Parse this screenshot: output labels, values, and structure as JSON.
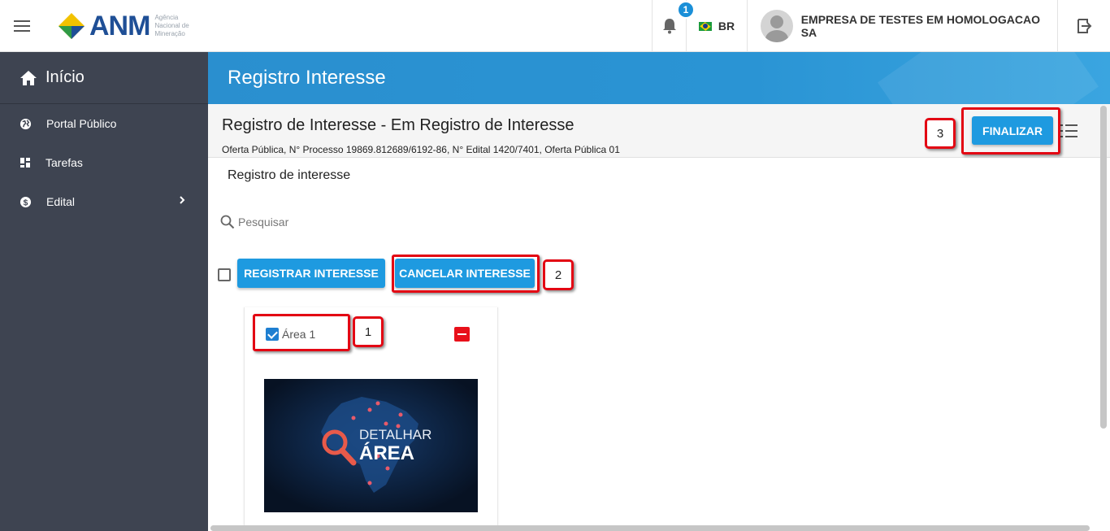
{
  "header": {
    "logo_text": "ANM",
    "logo_subtitle": "Agência Nacional de Mineração",
    "notification_count": "1",
    "language": "BR",
    "user_name": "EMPRESA DE TESTES EM HOMOLOGACAO SA"
  },
  "sidebar": {
    "home_label": "Início",
    "items": [
      {
        "label": "Portal Público",
        "icon": "globe-icon"
      },
      {
        "label": "Tarefas",
        "icon": "grid-icon"
      },
      {
        "label": "Edital",
        "icon": "dollar-icon"
      }
    ]
  },
  "page": {
    "banner_title": "Registro Interesse",
    "title": "Registro de Interesse - Em Registro de Interesse",
    "subtitle": "Oferta Pública, N° Processo 19869.812689/6192-86, N° Edital 1420/7401, Oferta Pública 01",
    "finalize_label": "FINALIZAR",
    "section_label": "Registro de interesse",
    "search_placeholder": "Pesquisar",
    "register_label": "REGISTRAR INTERESSE",
    "cancel_label": "CANCELAR INTERESSE"
  },
  "card": {
    "area_label": "Área 1",
    "checked": true,
    "image_line1": "DETALHAR",
    "image_line2": "ÁREA"
  },
  "annotations": [
    "1",
    "2",
    "3"
  ],
  "colors": {
    "accent": "#1e9ae0",
    "sidebar": "#3e4451",
    "annotation": "#e30613",
    "remove": "#e8101a"
  }
}
